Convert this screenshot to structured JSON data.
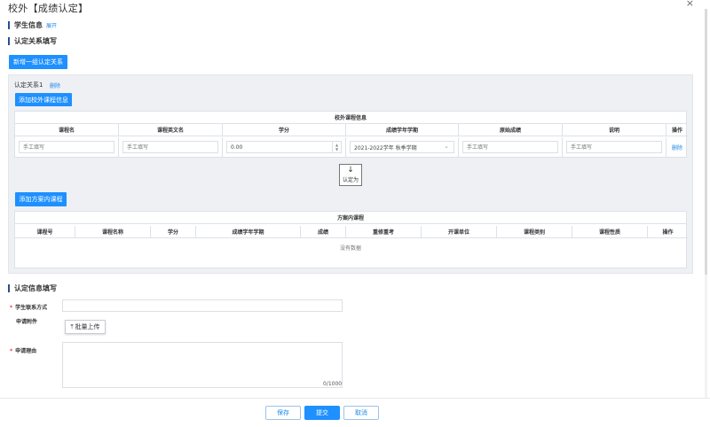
{
  "dialog": {
    "title": "校外【成绩认定】",
    "close": "×"
  },
  "student_info": {
    "title": "学生信息",
    "expand": "展开"
  },
  "relation": {
    "title": "认定关系填写",
    "add_group": "新增一组认定关系",
    "group_label": "认定关系1",
    "delete": "删除",
    "add_external": "添加校外课程信息",
    "external_table": {
      "caption": "校外课程信息",
      "headers": [
        "课程名",
        "课程英文名",
        "学分",
        "成绩学年学期",
        "原始成绩",
        "说明",
        "操作"
      ],
      "row": {
        "name_placeholder": "手工填写",
        "en_placeholder": "手工填写",
        "credit": "0.00",
        "term": "2021-2022学年 秋季学期",
        "score_placeholder": "手工填写",
        "note_placeholder": "手工填写",
        "op": "删除"
      }
    },
    "recognize": "认定为",
    "add_internal": "添加方案内课程",
    "internal_table": {
      "caption": "方案内课程",
      "headers": [
        "课程号",
        "课程名称",
        "学分",
        "成绩学年学期",
        "成绩",
        "重修重考",
        "开课单位",
        "课程类别",
        "课程性质",
        "操作"
      ],
      "empty": "没有数据"
    }
  },
  "recognition": {
    "title": "认定信息填写",
    "contact_label": "学生联系方式",
    "attachment_label": "申请附件",
    "upload": "批量上传",
    "reason_label": "申请理由",
    "counter": "0/1000",
    "required_mark": "*"
  },
  "footer": {
    "save": "保存",
    "submit": "提交",
    "cancel": "取消"
  },
  "colors": {
    "primary": "#1e90ff",
    "section_bar": "#2d4d8c",
    "required": "#e53935"
  }
}
